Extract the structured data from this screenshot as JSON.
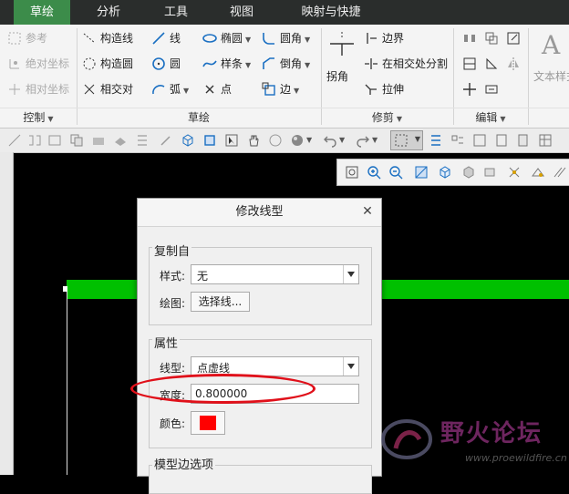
{
  "tabs": [
    "草绘",
    "分析",
    "工具",
    "视图",
    "映射与快捷"
  ],
  "ribbon": {
    "control": {
      "items": [
        "参考",
        "绝对坐标",
        "相对坐标"
      ],
      "label": "控制"
    },
    "sketch": {
      "col1": [
        "构造线",
        "构造圆",
        "相交对"
      ],
      "col2": [
        "线",
        "圆",
        "弧"
      ],
      "col3": [
        "椭圆",
        "样条",
        "点"
      ],
      "col4": [
        "圆角",
        "倒角",
        "边"
      ],
      "label": "草绘"
    },
    "trim": {
      "fillet": "拐角",
      "boundary": "边界",
      "split": "在相交处分割",
      "stretch": "拉伸",
      "label": "修剪"
    },
    "edit": {
      "label": "编辑"
    },
    "text": {
      "label": "文本样式"
    }
  },
  "dialog": {
    "title": "修改线型",
    "copy_from": {
      "title": "复制自",
      "style_label": "样式:",
      "style_value": "无",
      "drawing_label": "绘图:",
      "select_button": "选择线..."
    },
    "properties": {
      "title": "属性",
      "linetype_label": "线型:",
      "linetype_value": "点虚线",
      "width_label": "宽度:",
      "width_value": "0.800000",
      "color_label": "颜色:",
      "color_value": "#ff0000"
    },
    "model_edges": {
      "title": "模型边选项"
    }
  },
  "watermark": {
    "text": "野火论坛",
    "url": "www.proewildfire.cn"
  },
  "colors": {
    "tab_active": "#3c8c4a",
    "line_green": "#00c000",
    "highlight": "#e0101a"
  }
}
